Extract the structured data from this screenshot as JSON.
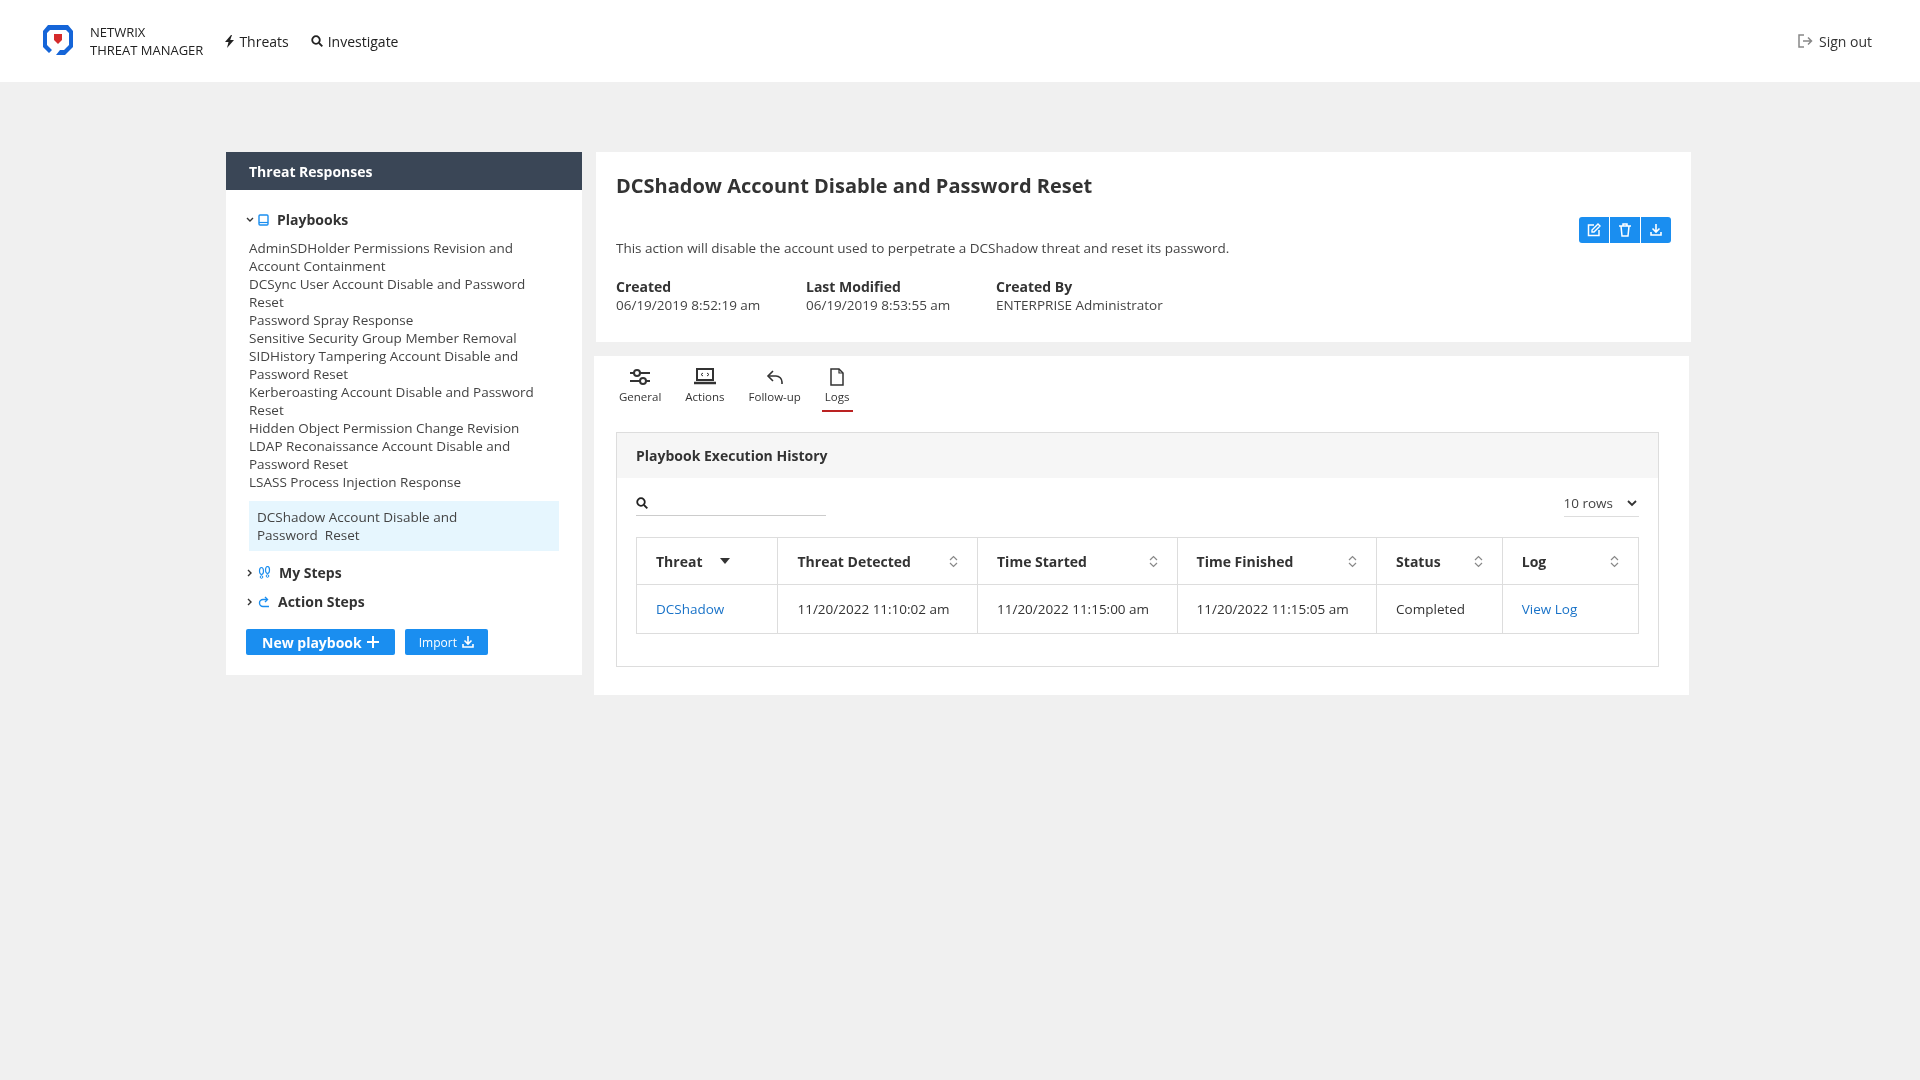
{
  "header": {
    "brand_line_1": "NETWRIX",
    "brand_line_2": "THREAT MANAGER",
    "nav": [
      {
        "label": "Threats",
        "kind": "bolt"
      },
      {
        "label": "Investigate",
        "kind": "search"
      }
    ],
    "sign_out": "Sign out"
  },
  "sidebar": {
    "title": "Threat Responses",
    "sections": [
      {
        "label": "Playbooks",
        "kind": "book",
        "expanded": true,
        "children": [
          {
            "label": "AdminSDHolder Permissions Revision and Account Containment",
            "selected": false
          },
          {
            "label": "DCSync User Account Disable and Password Reset",
            "selected": false
          },
          {
            "label": "Password Spray Response",
            "selected": false
          },
          {
            "label": "Sensitive Security Group Member Removal",
            "selected": false
          },
          {
            "label": "SIDHistory Tampering Account Disable and Password Reset",
            "selected": false
          },
          {
            "label": "Kerberoasting Account Disable and Password Reset",
            "selected": false
          },
          {
            "label": "Hidden Object Permission Change Revision",
            "selected": false
          },
          {
            "label": "LDAP Reconaissance Account Disable and Password Reset",
            "selected": false
          },
          {
            "label": "LSASS Process Injection Response",
            "selected": false
          },
          {
            "label": "DCShadow Account Disable and Password  Reset",
            "selected": true
          }
        ]
      },
      {
        "label": "My Steps",
        "kind": "steps",
        "expanded": false
      },
      {
        "label": "Action Steps",
        "kind": "action",
        "expanded": false
      }
    ],
    "buttons": [
      {
        "label": "New playbook",
        "kind": "plus"
      },
      {
        "label": "Import",
        "kind": "download"
      }
    ]
  },
  "detail": {
    "title": "DCShadow Account Disable and Password Reset",
    "description": "This action will disable the account used to perpetrate a DCShadow threat and reset its password.",
    "toolbar": [
      {
        "kind": "edit"
      },
      {
        "kind": "delete"
      },
      {
        "kind": "download"
      }
    ],
    "meta": [
      {
        "label": "Created",
        "value": "06/19/2019 8:52:19 am"
      },
      {
        "label": "Last Modified",
        "value": "06/19/2019 8:53:55 am"
      },
      {
        "label": "Created By",
        "value": "ENTERPRISE Administrator"
      }
    ]
  },
  "tabs": [
    {
      "label": "General",
      "kind": "sliders",
      "selected": false
    },
    {
      "label": "Actions",
      "kind": "laptop",
      "selected": false
    },
    {
      "label": "Follow-up",
      "kind": "reply",
      "selected": false
    },
    {
      "label": "Logs",
      "kind": "file",
      "selected": true
    }
  ],
  "history": {
    "title": "Playbook Execution History",
    "rows_select": "10 rows",
    "columns": [
      {
        "label": "Threat",
        "sorted": true
      },
      {
        "label": "Threat Detected",
        "sorted": false
      },
      {
        "label": "Time Started",
        "sorted": false
      },
      {
        "label": "Time Finished",
        "sorted": false
      },
      {
        "label": "Status",
        "sorted": false
      },
      {
        "label": "Log",
        "sorted": false
      }
    ],
    "rows": [
      [
        {
          "text": "DCShadow",
          "kind": "link"
        },
        {
          "text": "11/20/2022 11:10:02 am",
          "kind": "text"
        },
        {
          "text": "11/20/2022 11:15:00 am",
          "kind": "text"
        },
        {
          "text": "11/20/2022 11:15:05 am",
          "kind": "text"
        },
        {
          "text": "Completed",
          "kind": "text"
        },
        {
          "text": "View Log",
          "kind": "link"
        }
      ]
    ]
  }
}
